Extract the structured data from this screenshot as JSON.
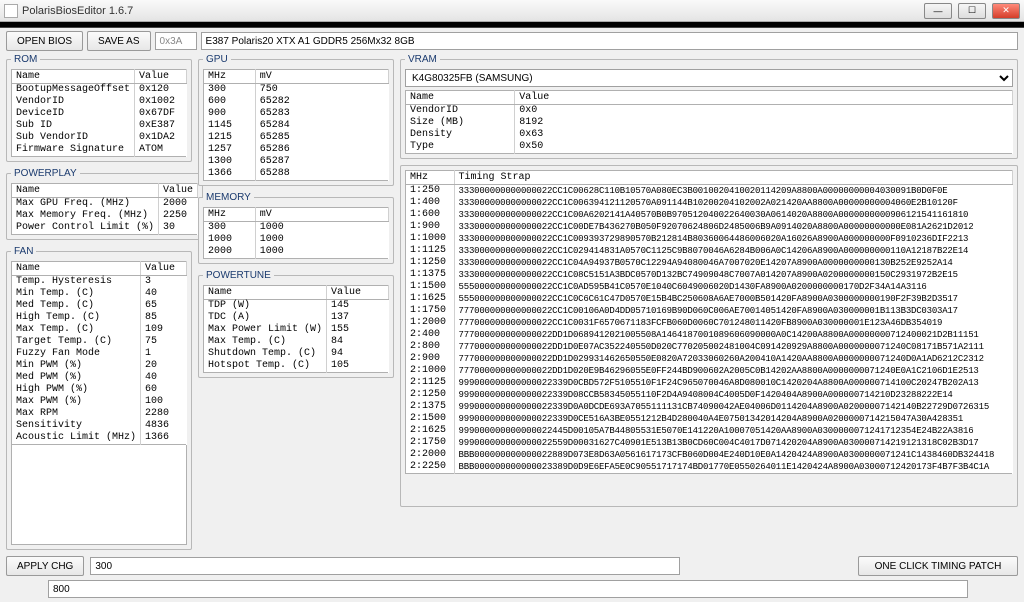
{
  "window": {
    "title": "PolarisBiosEditor 1.6.7",
    "min": "—",
    "max": "☐",
    "close": "✕"
  },
  "toolbar": {
    "open": "OPEN BIOS",
    "save": "SAVE AS",
    "field1": "0x3A",
    "desc": "E387 Polaris20 XTX A1 GDDR5 256Mx32 8GB"
  },
  "groups": {
    "rom": "ROM",
    "powerplay": "POWERPLAY",
    "fan": "FAN",
    "gpu": "GPU",
    "memory": "MEMORY",
    "powertune": "POWERTUNE",
    "vram": "VRAM"
  },
  "headers": {
    "name": "Name",
    "value": "Value",
    "mhz": "MHz",
    "mv": "mV",
    "timing": "Timing Strap"
  },
  "rom": [
    [
      "BootupMessageOffset",
      "0x120"
    ],
    [
      "VendorID",
      "0x1002"
    ],
    [
      "DeviceID",
      "0x67DF"
    ],
    [
      "Sub ID",
      "0xE387"
    ],
    [
      "Sub VendorID",
      "0x1DA2"
    ],
    [
      "Firmware Signature",
      "ATOM"
    ]
  ],
  "powerplay": [
    [
      "Max GPU Freq. (MHz)",
      "2000"
    ],
    [
      "Max Memory Freq. (MHz)",
      "2250"
    ],
    [
      "Power Control Limit (%)",
      "30"
    ]
  ],
  "fan": [
    [
      "Temp. Hysteresis",
      "3"
    ],
    [
      "Min Temp. (C)",
      "40"
    ],
    [
      "Med Temp. (C)",
      "65"
    ],
    [
      "High Temp. (C)",
      "85"
    ],
    [
      "Max Temp. (C)",
      "109"
    ],
    [
      "Target Temp. (C)",
      "75"
    ],
    [
      "Fuzzy Fan Mode",
      "1"
    ],
    [
      "Min PWM (%)",
      "20"
    ],
    [
      "Med PWM (%)",
      "40"
    ],
    [
      "High PWM (%)",
      "60"
    ],
    [
      "Max PWM (%)",
      "100"
    ],
    [
      "Max RPM",
      "2280"
    ],
    [
      "Sensitivity",
      "4836"
    ],
    [
      "Acoustic Limit (MHz)",
      "1366"
    ]
  ],
  "gpu": [
    [
      "300",
      "750"
    ],
    [
      "600",
      "65282"
    ],
    [
      "900",
      "65283"
    ],
    [
      "1145",
      "65284"
    ],
    [
      "1215",
      "65285"
    ],
    [
      "1257",
      "65286"
    ],
    [
      "1300",
      "65287"
    ],
    [
      "1366",
      "65288"
    ]
  ],
  "memory": [
    [
      "300",
      "1000"
    ],
    [
      "1000",
      "1000"
    ],
    [
      "2000",
      "1000"
    ]
  ],
  "powertune": [
    [
      "TDP (W)",
      "145"
    ],
    [
      "TDC (A)",
      "137"
    ],
    [
      "Max Power Limit (W)",
      "155"
    ],
    [
      "Max Temp. (C)",
      "84"
    ],
    [
      "Shutdown Temp. (C)",
      "94"
    ],
    [
      "Hotspot Temp. (C)",
      "105"
    ]
  ],
  "vram": {
    "selected": "K4G80325FB (SAMSUNG)",
    "rows": [
      [
        "VendorID",
        "0x0"
      ],
      [
        "Size (MB)",
        "8192"
      ],
      [
        "Density",
        "0x63"
      ],
      [
        "Type",
        "0x50"
      ]
    ]
  },
  "timing": [
    [
      "1:250",
      "333000000000000022CC1C00628C110B10570A080EC3B0010020410020114209A8800A00000000004030091B0D0F0E"
    ],
    [
      "1:400",
      "333000000000000022CC1C006394121120570A091144B10200204102002A021420AA8800A00000000004060E2B10120F"
    ],
    [
      "1:600",
      "333000000000000022CC1C00A6202141A40570B0B970512040022640030A0614020A8800A0000000000906121541161810"
    ],
    [
      "1:900",
      "333000000000000022CC1C00DE7B436270B050F92070624806D2485006B9A0914020A8800A00000000000E081A2621D2012"
    ],
    [
      "1:1000",
      "333000000000000022CC1C009393729890570B212814B80360064486006020A16026A8900A000000000F0910236DIF2213"
    ],
    [
      "1:1125",
      "333000000000000022CC1C029414831A0570C1125C9B8070046A6284B006A0C14206A8900A000000000110A12187B22E14"
    ],
    [
      "1:1250",
      "333000000000000022CC1C04A94937B0570C12294A94080046A7007020E14207A8900A0000000000130B252E9252A14"
    ],
    [
      "1:1375",
      "333000000000000022CC1C08C5151A3BDC0570D132BC74909048C7007A014207A8900A0200000000150C2931972B2E15"
    ],
    [
      "1:1500",
      "555000000000000022CC1C0AD595B41C0570E1040C6049006020D1430FA8900A0200000000170D2F34A14A3116"
    ],
    [
      "1:1625",
      "555000000000000022CC1C0C6C61C47D0570E15B4BC250608A6AE7000B501420FA8900A0300000000190F2F39B2D3517"
    ],
    [
      "1:1750",
      "777000000000000022CC1C00106A0D4DD05710169B90D060C006AE70014051420FA8900A030000001B113B3DC0303A17"
    ],
    [
      "1:2000",
      "777000000000000022CC1C0031F6570671183FCFB060D0060C701248011420FB8900A030000001E123A46DB354019"
    ],
    [
      "2:400",
      "777000000000000022DD1D0689412021005508A1464187001089606090000A0C14200A8800A00000000712400021D2B11151"
    ],
    [
      "2:800",
      "777000000000000022DD1D0E07AC352240550D020C770205002481004C091420929A8800A0000000071240C08171B571A2111"
    ],
    [
      "2:900",
      "777000000000000022DD1D029931462650550E0820A72033060260A200410A1420AA8800A0000000071240D0A1AD6212C2312"
    ],
    [
      "2:1000",
      "777000000000000022DD1D020E9B46296055E0FF244BD900602A2005C0B14202AA8800A0000000071240E0A1C2106D1E2513"
    ],
    [
      "2:1125",
      "999000000000000022339D0CBD572F5105510F1F24C965070046A8D080010C1420204A8800A000000714100C20247B202A13"
    ],
    [
      "2:1250",
      "999000000000000022339D08CCB58345055110F2D4A9408004C4005D0F1420404A8900A000000714210D23288222E14"
    ],
    [
      "2:1375",
      "999000000000000022339D0A0DCDE693A7055111131CB74090042AE04006D0114204A8900A02000007142140B22729D0726315"
    ],
    [
      "2:1500",
      "999000000000000022339D0CE516A3BE0551212B4D280040A4E07501342014204A8900A0200000714215047A30A428351"
    ],
    [
      "2:1625",
      "999000000000000022445D00105A7B44805531E5070E141220A10007051420AA8900A0300000071241712354E24B22A3816"
    ],
    [
      "2:1750",
      "999000000000000022559D00031627C40901E513B13B0CD60C004C4017D071420204A8900A030000714219121318C02B3D17"
    ],
    [
      "2:2000",
      "BBB000000000000022889D073E8D63A0561617173CFB060D004E240D10E0A1420424A8900A0300000071241C1438460DB324418"
    ],
    [
      "2:2250",
      "BBB000000000000023389D0D9E6EFA5E0C90551717174BD01770E0550264011E1420424A8900A03000712420173F4B7F3B4C1A"
    ]
  ],
  "bottom": {
    "apply": "APPLY CHG",
    "value": "300",
    "patch": "ONE CLICK TIMING PATCH",
    "status": "800"
  }
}
